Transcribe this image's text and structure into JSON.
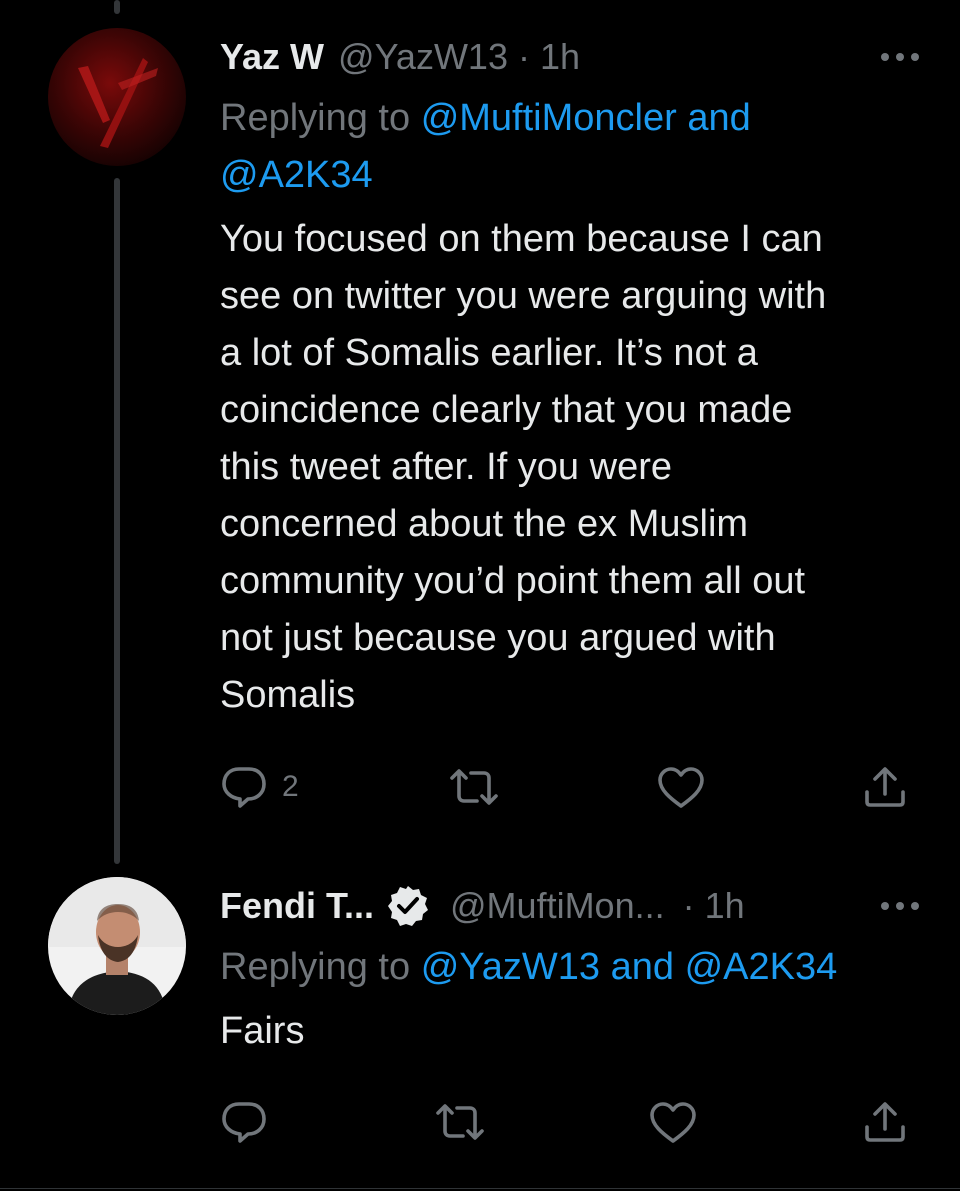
{
  "tweets": [
    {
      "display_name": "Yaz W",
      "handle": "@YazW13",
      "separator": "·",
      "time": "1h",
      "verified": false,
      "replying_prefix": "Replying to",
      "replying_mentions": "@MuftiMoncler and",
      "replying_mentions_2": "@A2K34",
      "text_lines": [
        "You focused on them because I can",
        "see on twitter you were arguing with",
        "a lot of Somalis earlier. It’s not a",
        "coincidence clearly that you made",
        "this tweet after. If you were",
        "concerned about the ex Muslim",
        "community you’d point them all out",
        "not just because you argued with",
        "Somalis"
      ],
      "reply_count": "2",
      "icons": [
        "reply-icon",
        "retweet-icon",
        "like-icon",
        "share-icon",
        "more-icon"
      ]
    },
    {
      "display_name": "Fendi T...",
      "handle": "@MuftiMon...",
      "separator": "·",
      "time": "1h",
      "verified": true,
      "replying_prefix": "Replying to",
      "replying_mentions": "@YazW13 and @A2K34",
      "text": "Fairs",
      "reply_count": "",
      "icons": [
        "reply-icon",
        "retweet-icon",
        "like-icon",
        "share-icon",
        "more-icon",
        "verified-badge-icon"
      ]
    }
  ],
  "colors": {
    "background": "#000000",
    "text_primary": "#e7e9ea",
    "text_secondary": "#71767b",
    "link": "#1d9bf0",
    "thread_line": "#333639"
  }
}
